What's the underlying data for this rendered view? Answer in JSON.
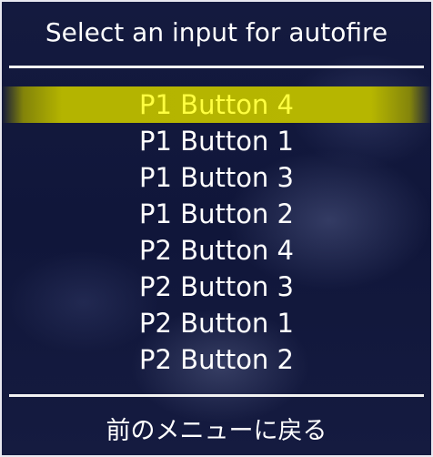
{
  "menu": {
    "title": "Select an input for autofire",
    "items": [
      {
        "label": "P1 Button 4",
        "selected": true
      },
      {
        "label": "P1 Button 1",
        "selected": false
      },
      {
        "label": "P1 Button 3",
        "selected": false
      },
      {
        "label": "P1 Button 2",
        "selected": false
      },
      {
        "label": "P2 Button 4",
        "selected": false
      },
      {
        "label": "P2 Button 3",
        "selected": false
      },
      {
        "label": "P2 Button 1",
        "selected": false
      },
      {
        "label": "P2 Button 2",
        "selected": false
      }
    ],
    "back_label": "前のメニューに戻る"
  },
  "colors": {
    "background": "#121839",
    "text": "#ffffff",
    "highlight_bar": "#b4b400",
    "highlight_text": "#ffff40",
    "border": "#e8e8f0"
  }
}
